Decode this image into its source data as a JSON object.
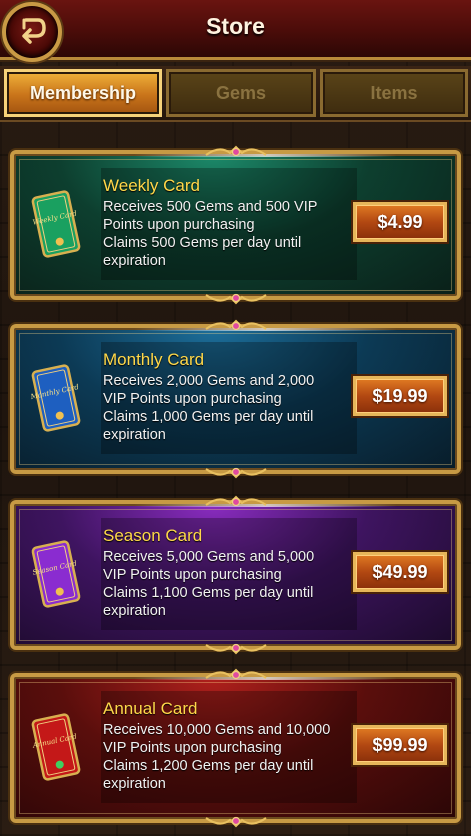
{
  "header": {
    "title": "Store"
  },
  "tabs": [
    {
      "label": "Membership",
      "active": true
    },
    {
      "label": "Gems",
      "active": false
    },
    {
      "label": "Items",
      "active": false
    }
  ],
  "cards": [
    {
      "title": "Weekly Card",
      "desc_line1": "Receives 500 Gems and 500 VIP",
      "desc_line2": "Points upon purchasing",
      "desc_line3": "Claims 500 Gems per day until",
      "desc_line4": "expiration",
      "price": "$4.99",
      "color": "#1aa060",
      "icon_text": "Weekly Card",
      "icon": "weekly-card-icon"
    },
    {
      "title": "Monthly Card",
      "desc_line1": "Receives 2,000 Gems and 2,000",
      "desc_line2": "VIP Points upon purchasing",
      "desc_line3": "Claims 1,000 Gems per day until",
      "desc_line4": "expiration",
      "price": "$19.99",
      "color": "#1e5fc0",
      "icon_text": "Monthly Card",
      "icon": "monthly-card-icon"
    },
    {
      "title": "Season Card",
      "desc_line1": "Receives 5,000 Gems and 5,000",
      "desc_line2": "VIP Points upon purchasing",
      "desc_line3": "Claims 1,100 Gems per day until",
      "desc_line4": "expiration",
      "price": "$49.99",
      "color": "#8a2cd0",
      "icon_text": "Season Card",
      "icon": "season-card-icon"
    },
    {
      "title": "Annual Card",
      "desc_line1": "Receives 10,000 Gems and 10,000",
      "desc_line2": "VIP Points upon purchasing",
      "desc_line3": "Claims 1,200 Gems per day until",
      "desc_line4": "expiration",
      "price": "$99.99",
      "color": "#c41818",
      "icon_text": "Annual Card",
      "icon": "annual-card-icon"
    }
  ],
  "colors": {
    "header_bg": "#4a0c09",
    "gold": "#c79a44",
    "title_yellow": "#ffd84a",
    "price_orange": "#b24812"
  }
}
